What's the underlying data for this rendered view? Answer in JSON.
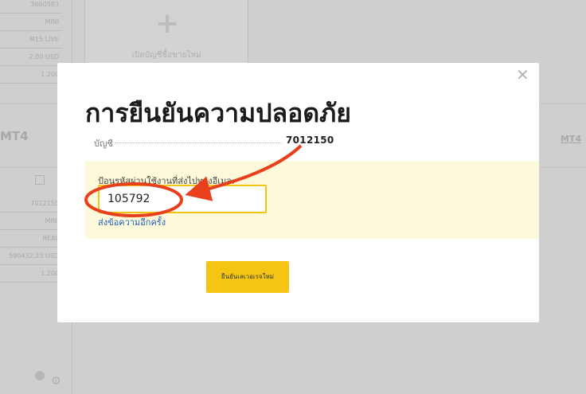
{
  "background": {
    "account_lines": [
      "3660583",
      "MINI",
      "M15 LIVE",
      "2.00 USD",
      "1.200"
    ],
    "account_lines_2": [
      "7012150",
      "MINI",
      "REAL",
      "590432.23 USD",
      "1.200"
    ],
    "new_account_label": "เปิดบัญชีซื้อขายใหม่",
    "platform_label": "MT4",
    "platform_link": "MT4"
  },
  "modal": {
    "title": "การยืนยันความปลอดภัย",
    "account_label": "บัญชี",
    "account_number": "7012150",
    "code_prompt": "ป้อนรหัสผ่านใช้งานที่ส่งไปทางอีเมล:",
    "code_value": "105792",
    "resend_link": "ส่งข้อความอีกครั้ง",
    "confirm_button": "ยืนยันเลเวอเรจใหม่",
    "close_icon": "close-icon"
  },
  "annotation": {
    "color": "#e8401c",
    "shapes": [
      "circle-highlight",
      "arrow"
    ]
  }
}
